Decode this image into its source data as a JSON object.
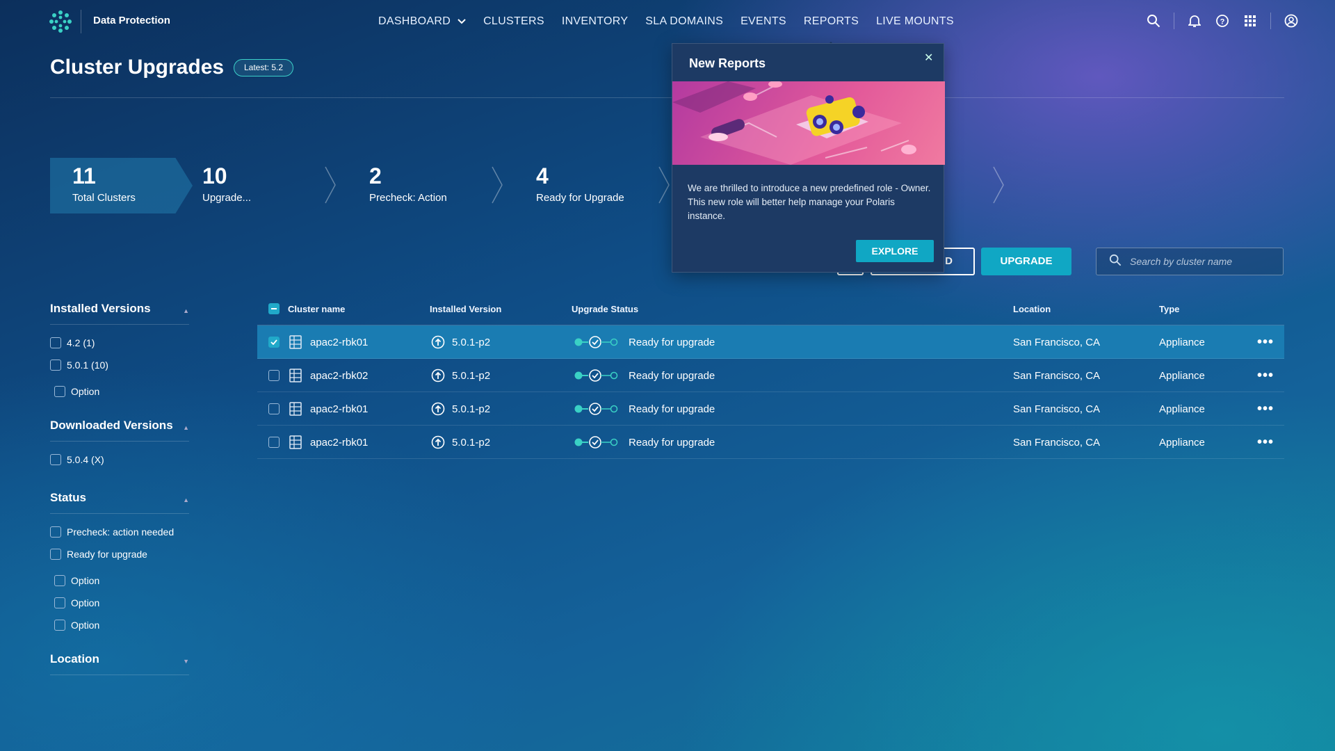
{
  "brand": "Data Protection",
  "nav": [
    {
      "label": "DASHBOARD"
    },
    {
      "label": "CLUSTERS"
    },
    {
      "label": "INVENTORY"
    },
    {
      "label": "SLA DOMAINS"
    },
    {
      "label": "EVENTS"
    },
    {
      "label": "REPORTS"
    },
    {
      "label": "LIVE MOUNTS"
    }
  ],
  "header": {
    "title": "Cluster Upgrades",
    "badge": "Latest: 5.2"
  },
  "stats": [
    {
      "num": "11",
      "label": "Total Clusters"
    },
    {
      "num": "10",
      "label": "Upgrade..."
    },
    {
      "num": "2",
      "label": "Precheck: Action"
    },
    {
      "num": "4",
      "label": "Ready for Upgrade"
    }
  ],
  "popover": {
    "title": "New Reports",
    "body": "We are thrilled to introduce a new predefined role - Owner. This new role will better help manage your Polaris instance.",
    "button": "EXPLORE"
  },
  "actions": {
    "download_partial": "D",
    "upgrade": "UPGRADE",
    "search_placeholder": "Search by cluster name"
  },
  "filters": {
    "installed": {
      "title": "Installed Versions",
      "options": [
        "4.2 (1)",
        "5.0.1 (10)",
        "Option"
      ]
    },
    "downloaded": {
      "title": "Downloaded Versions",
      "options": [
        "5.0.4 (X)"
      ]
    },
    "status": {
      "title": "Status",
      "options": [
        "Precheck: action needed",
        "Ready for upgrade",
        "Option",
        "Option",
        "Option"
      ]
    },
    "location": {
      "title": "Location"
    }
  },
  "table": {
    "headers": {
      "name": "Cluster name",
      "version": "Installed Version",
      "status": "Upgrade Status",
      "location": "Location",
      "type": "Type"
    },
    "rows": [
      {
        "name": "apac2-rbk01",
        "version": "5.0.1-p2",
        "status": "Ready for upgrade",
        "location": "San Francisco, CA",
        "type": "Appliance",
        "selected": true
      },
      {
        "name": "apac2-rbk02",
        "version": "5.0.1-p2",
        "status": "Ready for upgrade",
        "location": "San Francisco, CA",
        "type": "Appliance",
        "selected": false
      },
      {
        "name": "apac2-rbk01",
        "version": "5.0.1-p2",
        "status": "Ready for upgrade",
        "location": "San Francisco, CA",
        "type": "Appliance",
        "selected": false
      },
      {
        "name": "apac2-rbk01",
        "version": "5.0.1-p2",
        "status": "Ready for upgrade",
        "location": "San Francisco, CA",
        "type": "Appliance",
        "selected": false
      }
    ]
  },
  "colors": {
    "accent": "#10a7c4",
    "selected_row": "#1a7cb2"
  }
}
